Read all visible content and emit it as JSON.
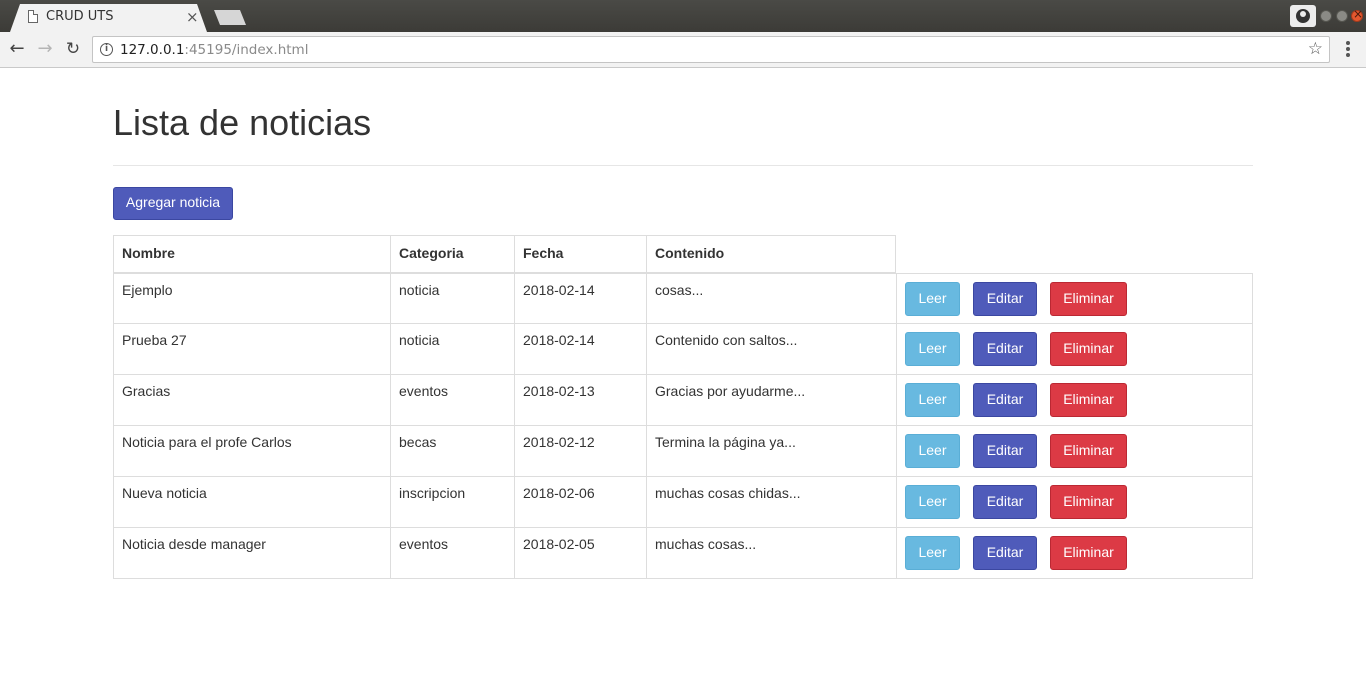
{
  "browser": {
    "tab_title": "CRUD UTS",
    "tab_close": "×",
    "url_host": "127.0.0.1",
    "url_rest": ":45195/index.html"
  },
  "page": {
    "title": "Lista de noticias",
    "add_button": "Agregar noticia"
  },
  "table": {
    "headers": [
      "Nombre",
      "Categoria",
      "Fecha",
      "Contenido"
    ],
    "action_labels": {
      "read": "Leer",
      "edit": "Editar",
      "delete": "Eliminar"
    },
    "rows": [
      [
        "Ejemplo",
        "noticia",
        "2018-02-14",
        "cosas..."
      ],
      [
        "Prueba 27",
        "noticia",
        "2018-02-14",
        "Contenido con saltos..."
      ],
      [
        "Gracias",
        "eventos",
        "2018-02-13",
        "Gracias por ayudarme..."
      ],
      [
        "Noticia para el profe Carlos",
        "becas",
        "2018-02-12",
        "Termina la página ya..."
      ],
      [
        "Nueva noticia",
        "inscripcion",
        "2018-02-06",
        "muchas cosas chidas..."
      ],
      [
        "Noticia desde manager",
        "eventos",
        "2018-02-05",
        "muchas cosas..."
      ]
    ]
  },
  "colors": {
    "primary": "#4f5bba",
    "info": "#68b9e0",
    "danger": "#dc3a45"
  }
}
